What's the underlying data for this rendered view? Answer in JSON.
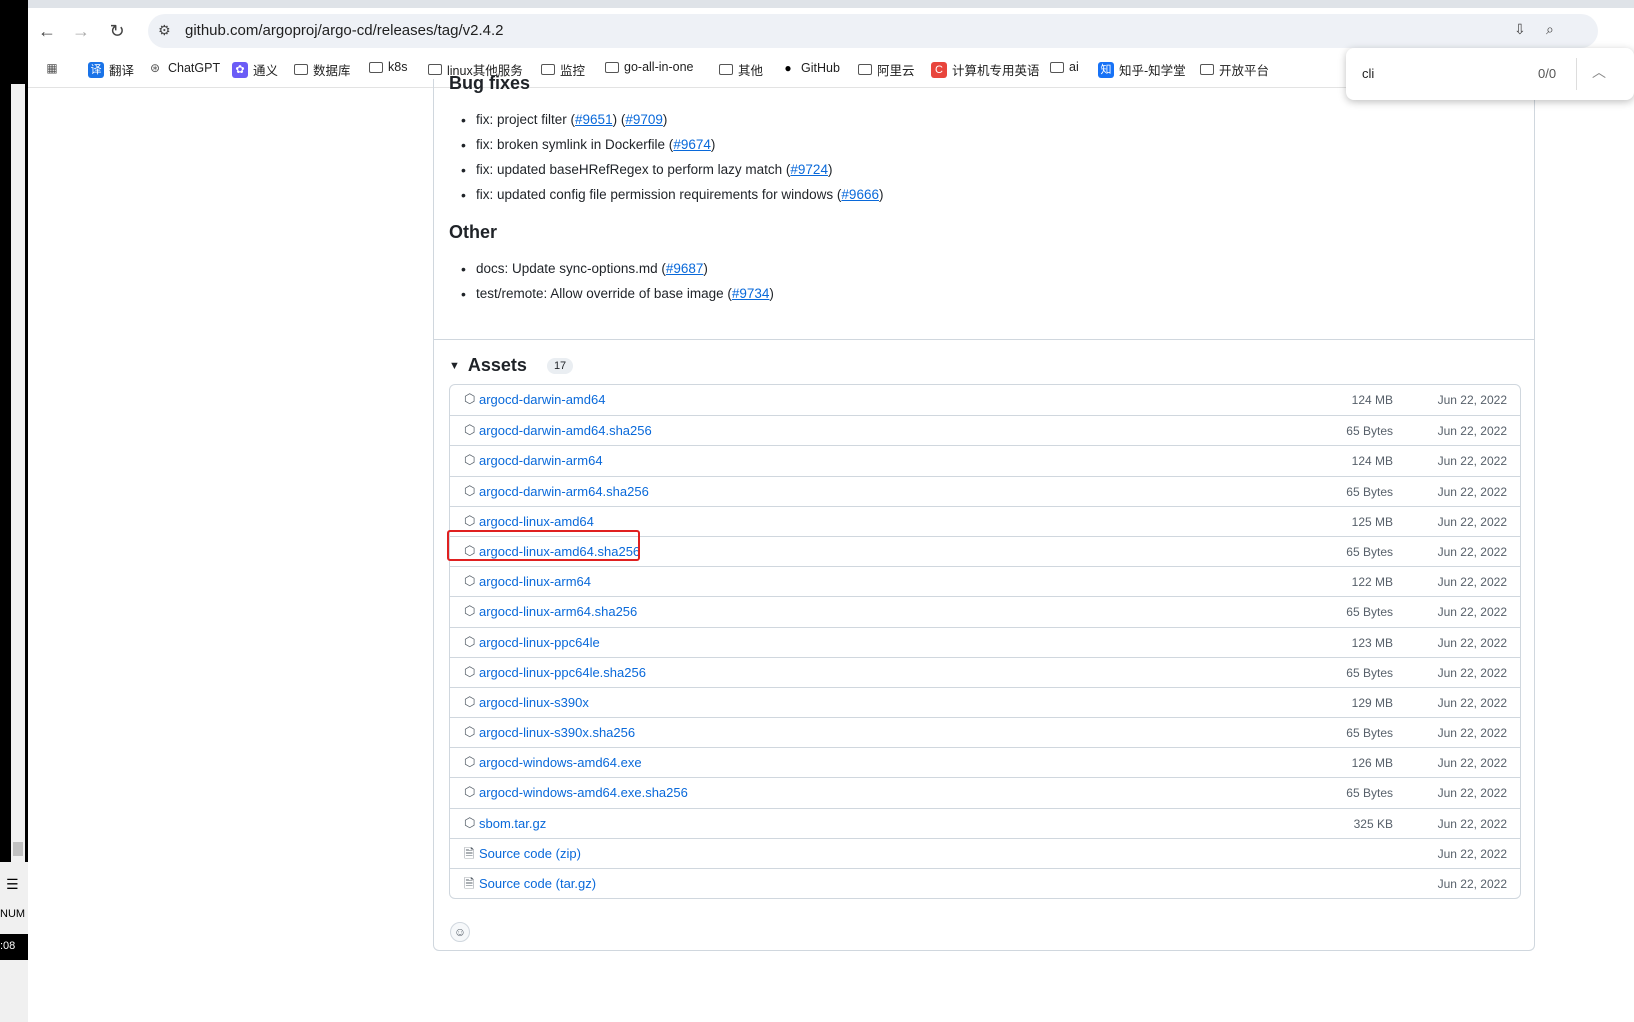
{
  "browser": {
    "url": "github.com/argoproj/argo-cd/releases/tag/v2.4.2",
    "bookmarks": [
      {
        "label": "翻译",
        "icon": "translate-icon"
      },
      {
        "label": "ChatGPT",
        "icon": "chatgpt-icon"
      },
      {
        "label": "通义",
        "icon": "tongyi-icon"
      },
      {
        "label": "数据库",
        "icon": "folder-icon"
      },
      {
        "label": "k8s",
        "icon": "folder-icon"
      },
      {
        "label": "linux其他服务",
        "icon": "folder-icon"
      },
      {
        "label": "监控",
        "icon": "folder-icon"
      },
      {
        "label": "go-all-in-one",
        "icon": "folder-icon"
      },
      {
        "label": "其他",
        "icon": "folder-icon"
      },
      {
        "label": "GitHub",
        "icon": "github-icon"
      },
      {
        "label": "阿里云",
        "icon": "folder-icon"
      },
      {
        "label": "计算机专用英语",
        "icon": "c-icon"
      },
      {
        "label": "ai",
        "icon": "folder-icon"
      },
      {
        "label": "知乎-知学堂",
        "icon": "zhihu-icon"
      },
      {
        "label": "开放平台",
        "icon": "folder-icon"
      }
    ]
  },
  "find": {
    "query": "cli",
    "count": "0/0"
  },
  "left_panel": {
    "num": "NUM",
    "time": ":08"
  },
  "release": {
    "bug_fixes_title": "Bug fixes",
    "bug_fixes": [
      {
        "pre": "fix: project filter (",
        "links": [
          "#9651",
          "#9709"
        ]
      },
      {
        "pre": "fix: broken symlink in Dockerfile (",
        "links": [
          "#9674"
        ]
      },
      {
        "pre": "fix: updated baseHRefRegex to perform lazy match (",
        "links": [
          "#9724"
        ]
      },
      {
        "pre": "fix: updated config file permission requirements for windows (",
        "links": [
          "#9666"
        ]
      }
    ],
    "other_title": "Other",
    "other": [
      {
        "pre": "docs: Update sync-options.md (",
        "links": [
          "#9687"
        ]
      },
      {
        "pre": "test/remote: Allow override of base image (",
        "links": [
          "#9734"
        ]
      }
    ],
    "assets_title": "Assets",
    "assets_count": "17",
    "assets": [
      {
        "name": "argocd-darwin-amd64",
        "size": "124 MB",
        "date": "Jun 22, 2022",
        "kind": "package"
      },
      {
        "name": "argocd-darwin-amd64.sha256",
        "size": "65 Bytes",
        "date": "Jun 22, 2022",
        "kind": "package"
      },
      {
        "name": "argocd-darwin-arm64",
        "size": "124 MB",
        "date": "Jun 22, 2022",
        "kind": "package"
      },
      {
        "name": "argocd-darwin-arm64.sha256",
        "size": "65 Bytes",
        "date": "Jun 22, 2022",
        "kind": "package"
      },
      {
        "name": "argocd-linux-amd64",
        "size": "125 MB",
        "date": "Jun 22, 2022",
        "kind": "package"
      },
      {
        "name": "argocd-linux-amd64.sha256",
        "size": "65 Bytes",
        "date": "Jun 22, 2022",
        "kind": "package"
      },
      {
        "name": "argocd-linux-arm64",
        "size": "122 MB",
        "date": "Jun 22, 2022",
        "kind": "package"
      },
      {
        "name": "argocd-linux-arm64.sha256",
        "size": "65 Bytes",
        "date": "Jun 22, 2022",
        "kind": "package"
      },
      {
        "name": "argocd-linux-ppc64le",
        "size": "123 MB",
        "date": "Jun 22, 2022",
        "kind": "package"
      },
      {
        "name": "argocd-linux-ppc64le.sha256",
        "size": "65 Bytes",
        "date": "Jun 22, 2022",
        "kind": "package"
      },
      {
        "name": "argocd-linux-s390x",
        "size": "129 MB",
        "date": "Jun 22, 2022",
        "kind": "package"
      },
      {
        "name": "argocd-linux-s390x.sha256",
        "size": "65 Bytes",
        "date": "Jun 22, 2022",
        "kind": "package"
      },
      {
        "name": "argocd-windows-amd64.exe",
        "size": "126 MB",
        "date": "Jun 22, 2022",
        "kind": "package"
      },
      {
        "name": "argocd-windows-amd64.exe.sha256",
        "size": "65 Bytes",
        "date": "Jun 22, 2022",
        "kind": "package"
      },
      {
        "name": "sbom.tar.gz",
        "size": "325 KB",
        "date": "Jun 22, 2022",
        "kind": "package"
      },
      {
        "name": "Source code",
        "sub": "(zip)",
        "size": "",
        "date": "Jun 22, 2022",
        "kind": "zip"
      },
      {
        "name": "Source code",
        "sub": "(tar.gz)",
        "size": "",
        "date": "Jun 22, 2022",
        "kind": "zip"
      }
    ]
  }
}
